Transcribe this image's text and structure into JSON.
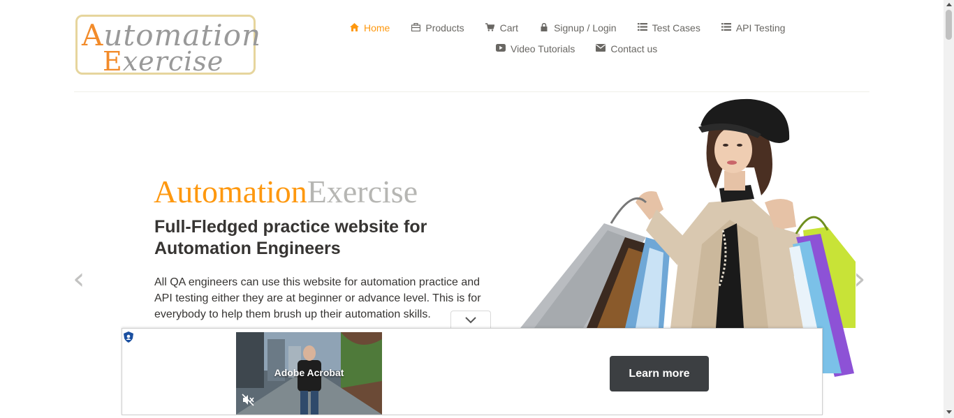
{
  "logo": {
    "line1_cap": "A",
    "line1_rest": "utomation",
    "line2_cap": "E",
    "line2_rest": "xercise"
  },
  "nav": {
    "items": [
      {
        "label": "Home",
        "icon": "home-icon",
        "active": true
      },
      {
        "label": "Products",
        "icon": "products-icon"
      },
      {
        "label": "Cart",
        "icon": "cart-icon"
      },
      {
        "label": "Signup / Login",
        "icon": "lock-icon"
      },
      {
        "label": "Test Cases",
        "icon": "list-icon"
      },
      {
        "label": "API Testing",
        "icon": "list-icon"
      },
      {
        "label": "Video Tutorials",
        "icon": "youtube-icon"
      },
      {
        "label": "Contact us",
        "icon": "envelope-icon"
      }
    ]
  },
  "slider": {
    "brand_a": "Automation",
    "brand_b": "Exercise",
    "headline": "Full-Fledged practice website for Automation Engineers",
    "description": "All QA engineers can use this website for automation practice and API testing either they are at beginner or advance level. This is for everybody to help them brush up their automation skills.",
    "prev_icon": "chevron-left-icon",
    "next_icon": "chevron-right-icon"
  },
  "ad": {
    "video_title": "Adobe Acrobat",
    "learn_more": "Learn more"
  },
  "colors": {
    "accent": "#fe980f",
    "grey_text": "#b6b6b3",
    "dark_button": "#3c3f42"
  }
}
